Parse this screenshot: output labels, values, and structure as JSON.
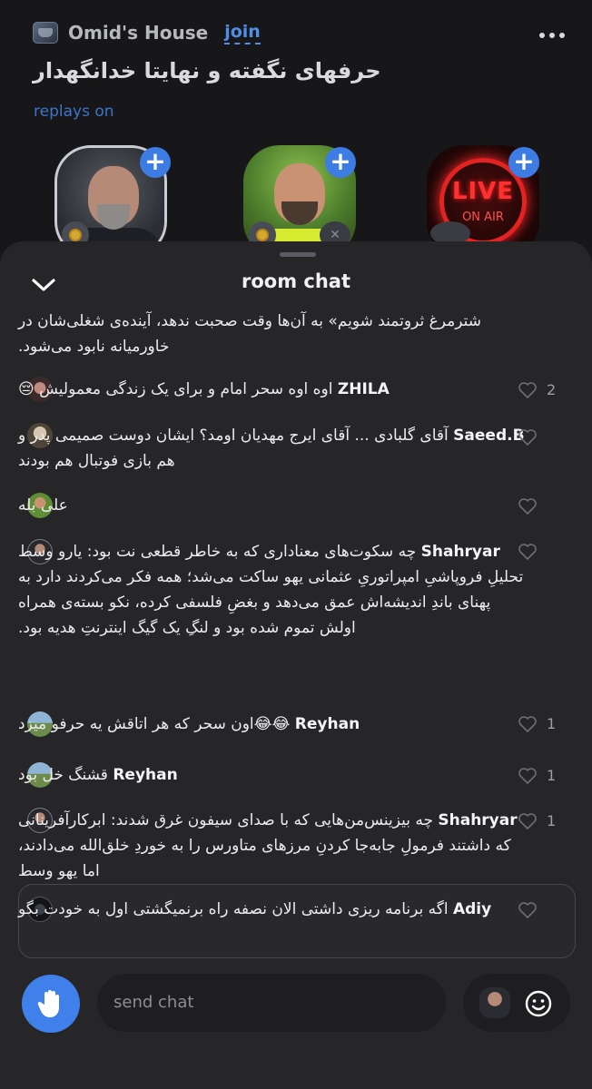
{
  "header": {
    "club_name": "Omid's House",
    "join_label": "join",
    "room_title": "حرفهای نگفته و نهایتا خدانگهدار",
    "replays_label": "replays on"
  },
  "speakers": [
    {
      "name": "speaker-1",
      "icon": "speaker-avatar"
    },
    {
      "name": "speaker-2",
      "icon": "speaker-avatar"
    },
    {
      "name": "speaker-3",
      "live_text": "LIVE",
      "onair_text": "ON AIR"
    }
  ],
  "sheet": {
    "title": "room chat"
  },
  "messages": [
    {
      "user": "",
      "text": "شترمرغ ثروتمند شویم» به آن‌ها وقت صحبت ندهد، آینده‌ی شغلی‌شان در خاورمیانه نابود می‌شود."
    },
    {
      "user": "ZHILA",
      "text": "اوه اوه سحر امام و برای یک زندگی معمولیش 😔",
      "likes": "2"
    },
    {
      "user": "Saeed.B",
      "text": "آقای گلبادی ... آقای ایرج مهدیان اومد؟ ایشان دوست صمیمی پدر و هم بازی فوتبال هم بودند"
    },
    {
      "user": "",
      "text": "علی بله"
    },
    {
      "user": "Shahryar",
      "text": "چه سکوت‌های معناداری که به خاطر قطعی نت بود: یارو وسط تحلیلِ فروپاشیِ امپراتوریِ عثمانی یهو ساکت می‌شد؛ همه فکر می‌کردند دارد به پهنای باندِ اندیشه‌اش عمق می‌دهد و بغضِ فلسفی کرده، نکو بسته‌ی همراه اولش تموم شده بود و لنگِ یک گیگ اینترنتِ هدیه بود."
    },
    {
      "user": "Reyhan",
      "text": "😂😂اون  سحر که هر اتاقش یه حرفو میزد",
      "likes": "1"
    },
    {
      "user": "Reyhan",
      "text": "قشنگ خل بود",
      "likes": "1"
    },
    {
      "user": "Shahryar",
      "text": "چه بیزینس‌من‌هایی که با صدای سیفون غرق شدند: ابرکارآفرینانی که داشتند فرمولِ جابه‌جا کردنِ مرزهای متاورس را به خوردِ خلق‌الله می‌دادند، اما یهو وسط",
      "likes": "1"
    },
    {
      "user": "Adiy",
      "text": "اگه برنامه ریزی داشتی الان نصفه راه برنمیگشتی اول به خودت بگو"
    }
  ],
  "composer": {
    "placeholder": "send chat"
  },
  "colors": {
    "accent": "#3f80ea",
    "join": "#4f8fe8",
    "sheet_bg": "#262629"
  }
}
